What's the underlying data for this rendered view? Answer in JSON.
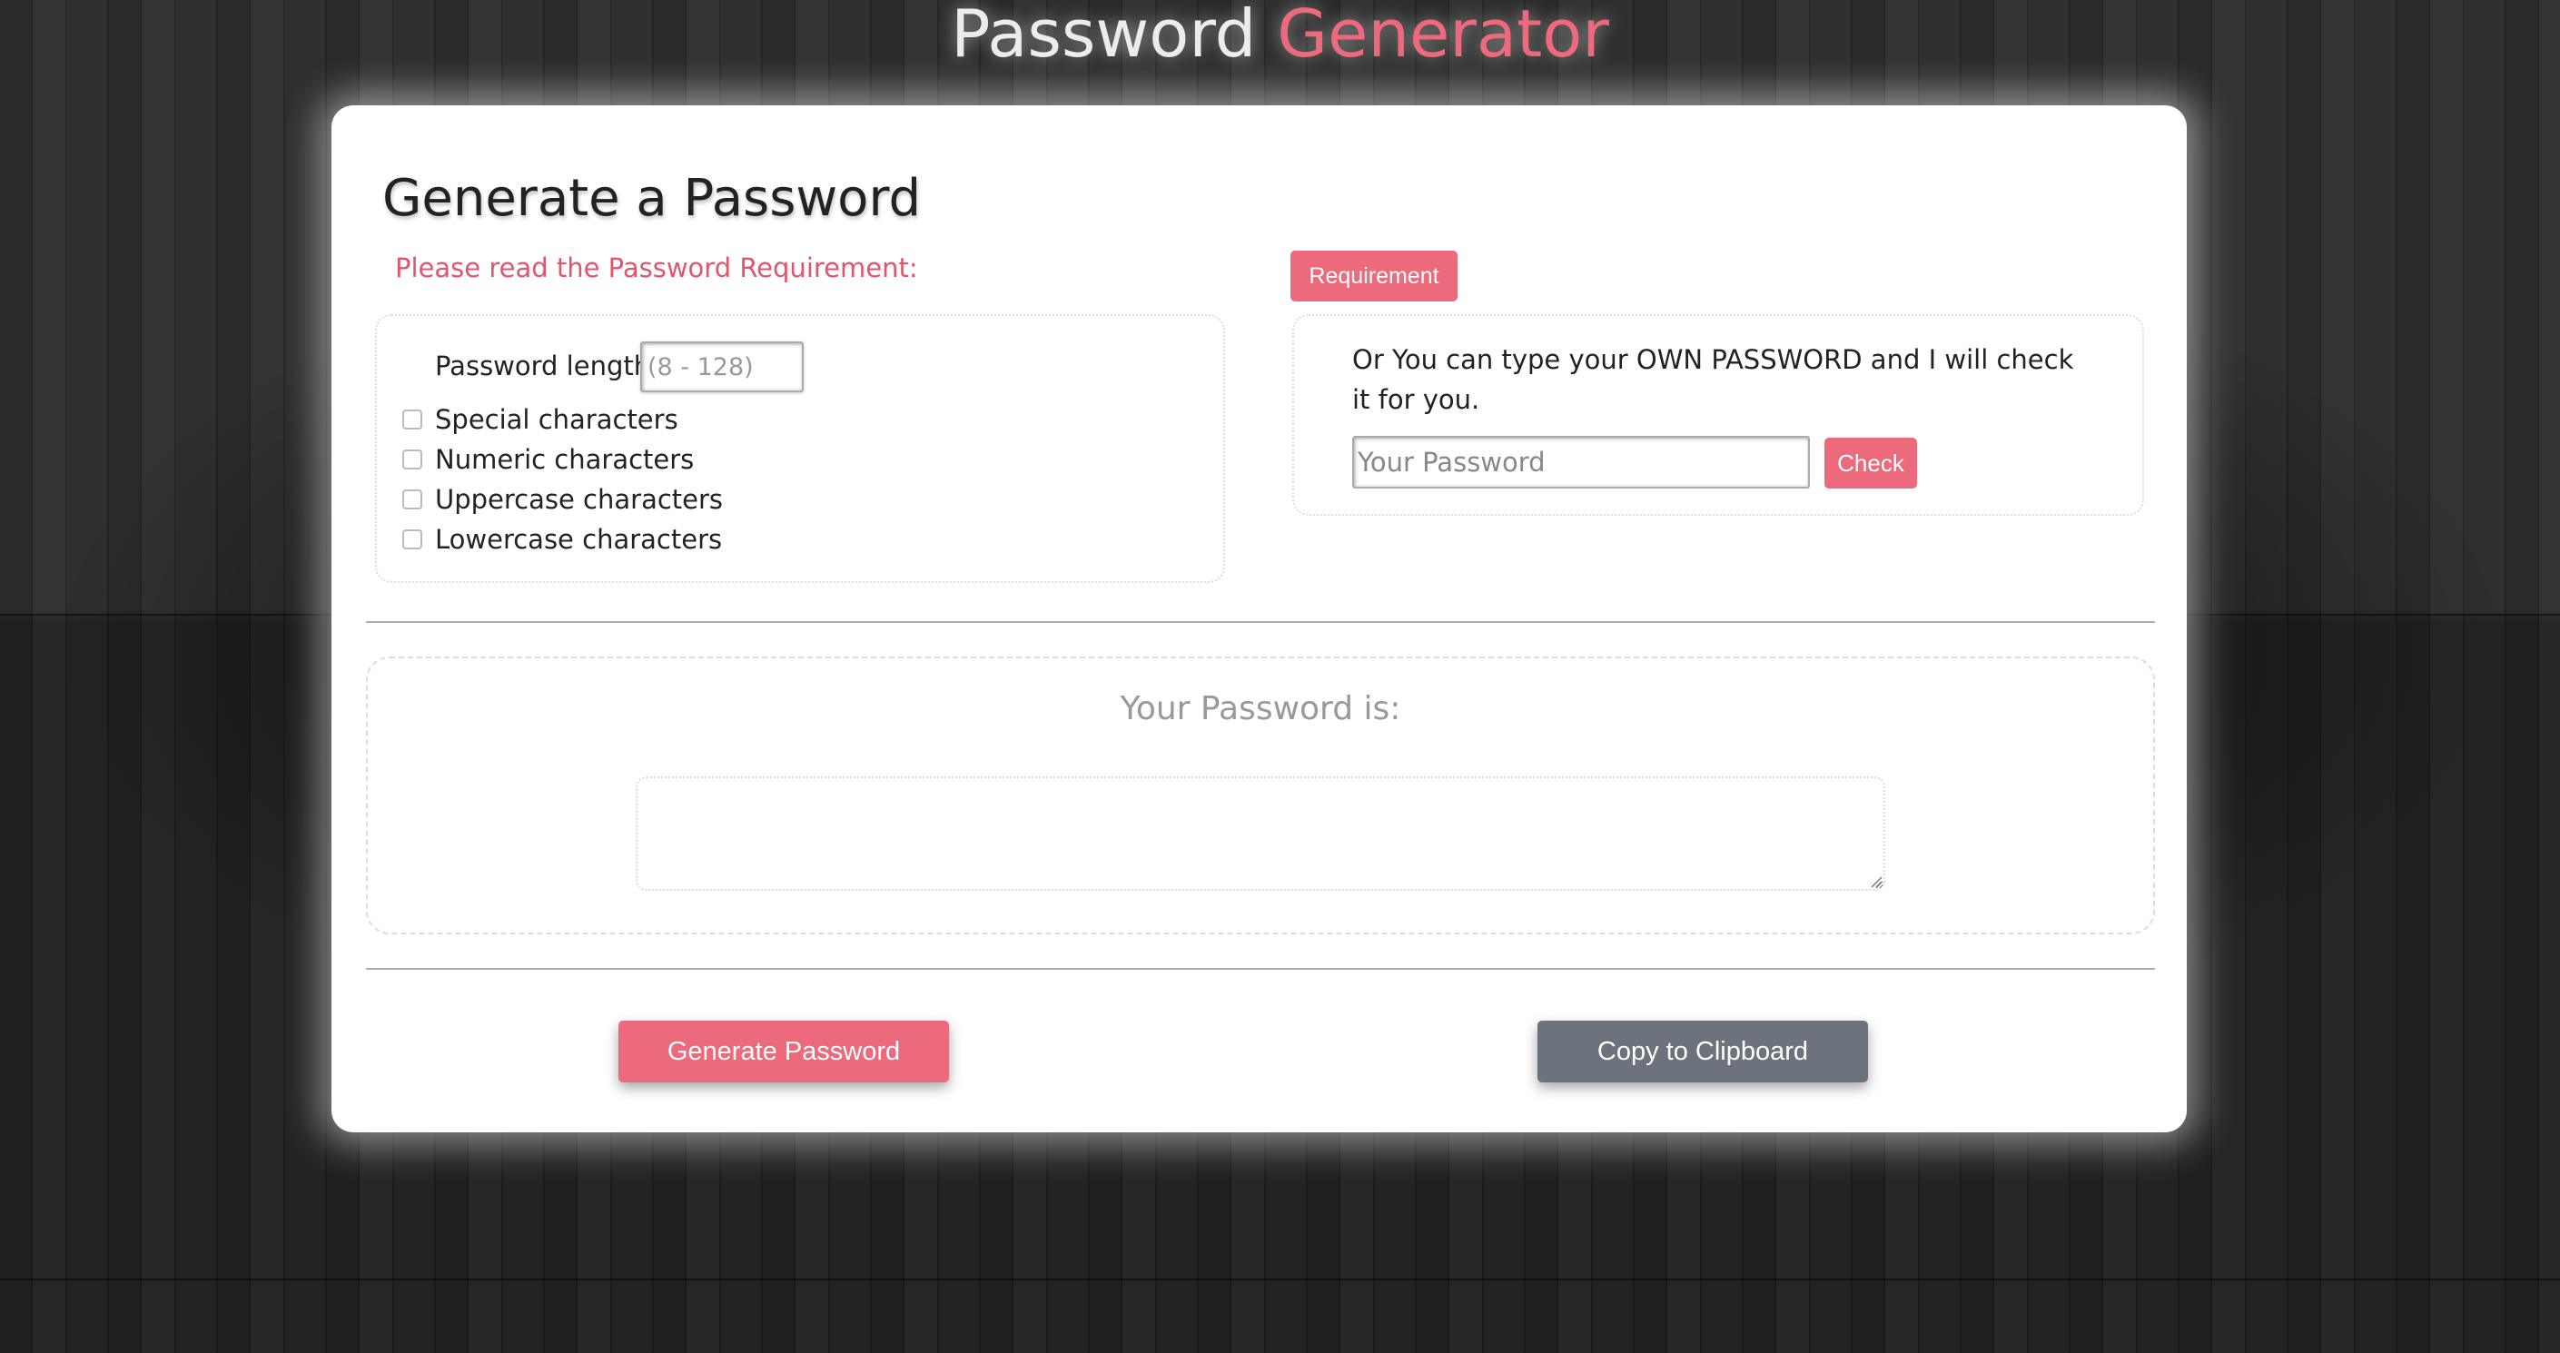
{
  "header": {
    "title_main": "Password",
    "title_accent": "Generator"
  },
  "form": {
    "heading": "Generate a Password",
    "requirement_note": "Please read the Password Requirement:",
    "requirement_button": "Requirement",
    "length_label": "Password length",
    "length_placeholder": "(8 - 128)",
    "options": [
      {
        "label": "Special characters",
        "checked": false
      },
      {
        "label": "Numeric characters",
        "checked": false
      },
      {
        "label": "Uppercase characters",
        "checked": false
      },
      {
        "label": "Lowercase characters",
        "checked": false
      }
    ]
  },
  "own_password": {
    "text": "Or You can type your OWN PASSWORD and I will check it for you.",
    "placeholder": "Your Password",
    "check_button": "Check"
  },
  "result": {
    "title": "Your Password is:",
    "value": ""
  },
  "actions": {
    "generate": "Generate Password",
    "copy": "Copy to Clipboard"
  },
  "colors": {
    "accent": "#ec6a7c",
    "secondary": "#6c737c"
  }
}
